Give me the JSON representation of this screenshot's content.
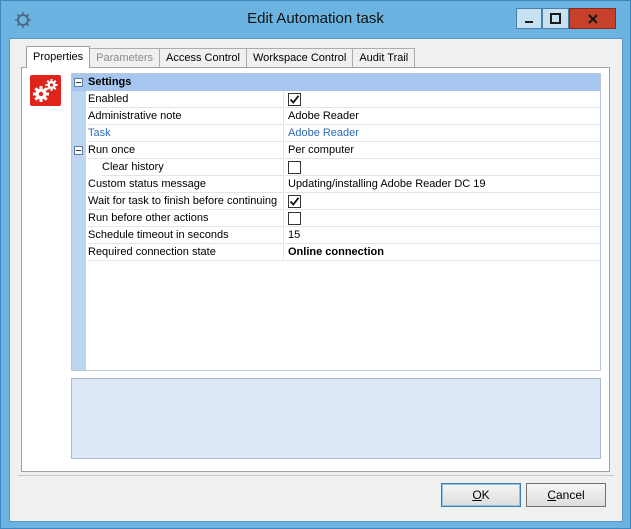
{
  "window": {
    "title": "Edit Automation task",
    "icon": "automation-app-icon",
    "controls": [
      "minimize",
      "maximize",
      "close"
    ],
    "accent": "#6bb4e2",
    "close_color": "#c7402a"
  },
  "tabs": [
    {
      "label": "Properties",
      "active": true,
      "enabled": true
    },
    {
      "label": "Parameters",
      "active": false,
      "enabled": false
    },
    {
      "label": "Access Control",
      "active": false,
      "enabled": true
    },
    {
      "label": "Workspace Control",
      "active": false,
      "enabled": true
    },
    {
      "label": "Audit Trail",
      "active": false,
      "enabled": true
    }
  ],
  "category_icon": {
    "name": "gears-icon",
    "color": "#e0241b"
  },
  "grid": {
    "category": "Settings",
    "rows": [
      {
        "name": "Enabled",
        "value": "",
        "checkbox": true,
        "checked": true
      },
      {
        "name": "Administrative note",
        "value": "Adobe Reader"
      },
      {
        "name": "Task",
        "value": "Adobe Reader",
        "link": true
      },
      {
        "name": "Run once",
        "value": "Per computer",
        "expandable": true
      },
      {
        "name": "Clear history",
        "value": "",
        "checkbox": true,
        "checked": false,
        "child": true
      },
      {
        "name": "Custom status message",
        "value": "Updating/installing Adobe Reader DC 19"
      },
      {
        "name": "Wait for task to finish before continuing",
        "value": "",
        "checkbox": true,
        "checked": true
      },
      {
        "name": "Run before other actions",
        "value": "",
        "checkbox": true,
        "checked": false
      },
      {
        "name": "Schedule timeout in seconds",
        "value": "15"
      },
      {
        "name": "Required connection state",
        "value": "Online connection",
        "bold": true
      }
    ]
  },
  "buttons": {
    "ok": {
      "prefix": "",
      "mnemonic": "O",
      "suffix": "K"
    },
    "cancel": {
      "prefix": "",
      "mnemonic": "C",
      "suffix": "ancel"
    }
  },
  "colors": {
    "category_band": "#a7c6ef",
    "grid_margin": "#bcd6f2",
    "description_panel": "#dce8f6",
    "link": "#2f6ab5"
  }
}
